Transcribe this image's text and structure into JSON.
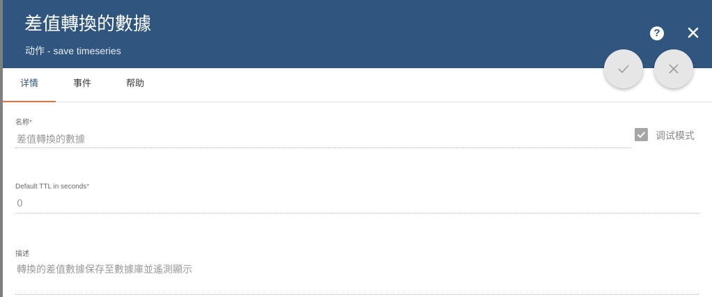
{
  "header": {
    "title": "差值轉換的數據",
    "subtitle": "动作 - save timeseries",
    "help_icon_glyph": "?",
    "color": "#305680"
  },
  "tabs": [
    {
      "label": "详情",
      "active": true
    },
    {
      "label": "事件",
      "active": false
    },
    {
      "label": "帮助",
      "active": false
    }
  ],
  "form": {
    "name": {
      "label": "名称",
      "required_mark": "*",
      "value": "差值轉換的數據"
    },
    "debug_mode": {
      "label": "调试模式",
      "checked": true
    },
    "ttl": {
      "label": "Default TTL in seconds",
      "required_mark": "*",
      "value": "0"
    },
    "description": {
      "label": "描述",
      "value": "轉換的差值數據保存至數據庫並遙測顯示"
    }
  },
  "accent_color": "#ef6c3a"
}
